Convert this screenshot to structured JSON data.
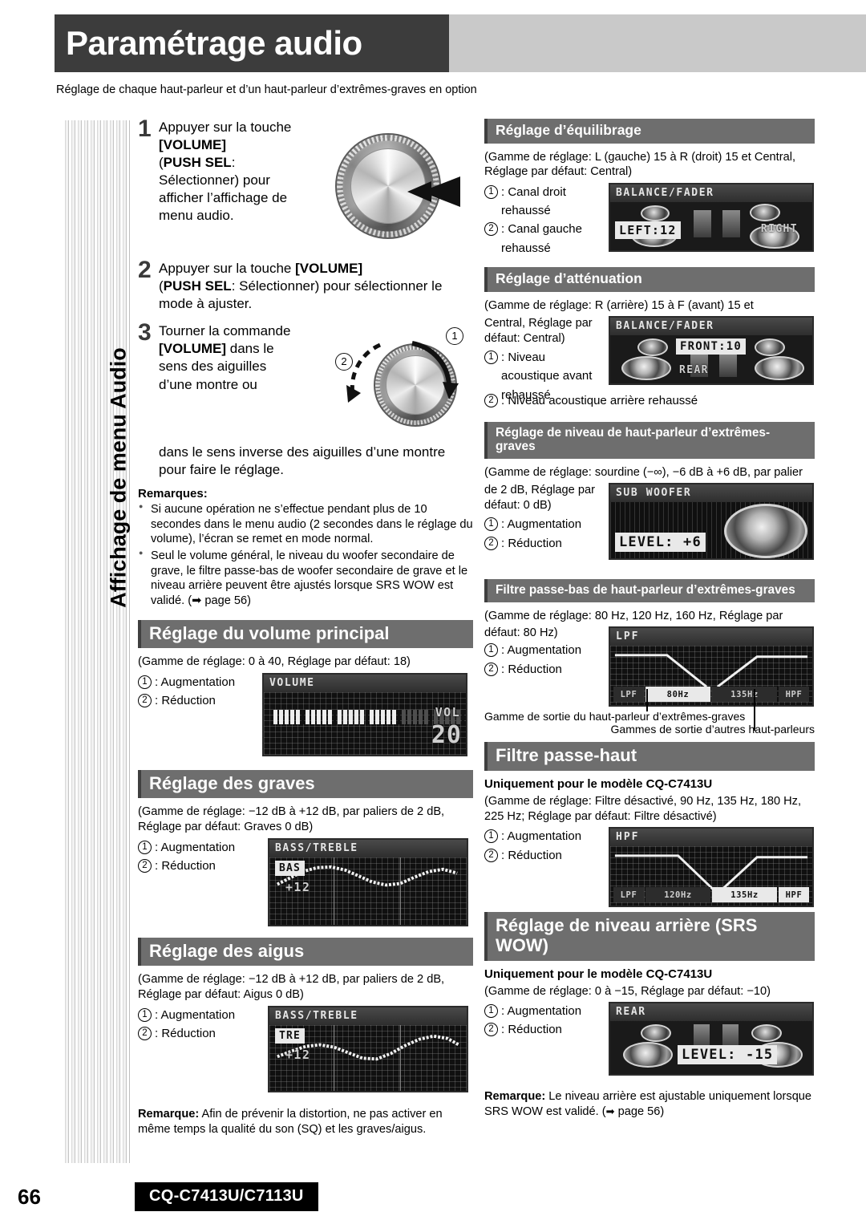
{
  "header": {
    "title": "Paramétrage audio",
    "subtitle": "Réglage de chaque haut-parleur et d’un haut-parleur d’extrêmes-graves en option"
  },
  "side_tab": {
    "label": "Affichage de menu Audio"
  },
  "steps": [
    {
      "num": "1",
      "html": "Appuyer sur la touche [VOLUME] (PUSH SEL: Sélectionner) pour afficher l’affichage de menu audio."
    },
    {
      "num": "2",
      "html": "Appuyer sur la touche [VOLUME] (PUSH SEL: Sélectionner) pour sélectionner le mode à ajuster."
    },
    {
      "num": "3",
      "html": "Tourner la commande [VOLUME] dans le sens des aiguilles d’une montre ou dans le sens inverse des aiguilles d’une montre pour faire le réglage."
    }
  ],
  "knob_marks": {
    "one": "1",
    "two": "2"
  },
  "remarques": {
    "title": "Remarques:",
    "items": [
      "Si aucune opération ne s’effectue pendant plus de 10 secondes dans le menu audio (2 secondes dans le réglage du volume), l’écran se remet en mode normal.",
      "Seul le volume général, le niveau du woofer secondaire de grave, le filtre passe-bas de woofer secondaire de grave et le niveau arrière peuvent être ajustés lorsque SRS WOW est validé. (➡ page 56)"
    ]
  },
  "sections": {
    "volume": {
      "heading": "Réglage du volume principal",
      "range": "(Gamme de réglage: 0 à 40, Réglage par défaut: 18)",
      "opt1": ": Augmentation",
      "opt2": ": Réduction",
      "lcd": {
        "title": "VOLUME",
        "label": "VOL",
        "value": "20",
        "bars_on": 20,
        "bars_total": 40
      }
    },
    "bass": {
      "heading": "Réglage des graves",
      "range": "(Gamme de réglage: −12 dB à +12 dB, par paliers de 2 dB, Réglage par défaut: Graves 0 dB)",
      "opt1": ": Augmentation",
      "opt2": ": Réduction",
      "lcd": {
        "title": "BASS/TREBLE",
        "tag": "BAS",
        "value": "+12"
      }
    },
    "treble": {
      "heading": "Réglage des aigus",
      "range": "(Gamme de réglage: −12 dB à +12 dB, par paliers de 2 dB, Réglage par défaut: Aigus 0 dB)",
      "opt1": ": Augmentation",
      "opt2": ": Réduction",
      "lcd": {
        "title": "BASS/TREBLE",
        "tag": "TRE",
        "value": "+12"
      }
    },
    "bass_treble_note": "Remarque: Afin de prévenir la distortion, ne pas activer en même temps la qualité du son (SQ) et les graves/aigus.",
    "balance": {
      "heading": "Réglage d’équilibrage",
      "range": "(Gamme de réglage: L (gauche) 15 à R (droit) 15 et Central, Réglage par défaut: Central)",
      "opt1": ": Canal droit rehaussé",
      "opt2": ": Canal gauche rehaussé",
      "lcd": {
        "title": "BALANCE/FADER",
        "value": "LEFT:12",
        "right_label": "RIGHT"
      }
    },
    "fader": {
      "heading": "Réglage d’atténuation",
      "range": "(Gamme de réglage: R (arrière) 15 à F (avant) 15 et Central, Réglage par défaut: Central)",
      "opt1": ": Niveau acoustique avant rehaussé",
      "opt2": ": Niveau acoustique arrière rehaussé",
      "lcd": {
        "title": "BALANCE/FADER",
        "value": "FRONT:10",
        "bottom_label": "REAR"
      }
    },
    "subwoofer": {
      "heading": "Réglage de niveau de haut-parleur d’extrêmes-graves",
      "range": "(Gamme de réglage: sourdine (−∞), −6 dB à +6 dB, par palier de 2 dB, Réglage par défaut: 0 dB)",
      "opt1": ": Augmentation",
      "opt2": ": Réduction",
      "lcd": {
        "title": "SUB WOOFER",
        "value": "LEVEL: +6"
      }
    },
    "lpf": {
      "heading": "Filtre passe-bas de haut-parleur d’extrêmes-graves",
      "range": "(Gamme de réglage: 80 Hz, 120 Hz, 160 Hz, Réglage par défaut: 80 Hz)",
      "opt1": ": Augmentation",
      "opt2": ": Réduction",
      "lcd": {
        "title": "LPF",
        "chips": [
          "LPF",
          "80Hz",
          "135Hz",
          "HPF"
        ],
        "active_index": 1
      },
      "caption1": "Gamme de sortie du haut-parleur d’extrêmes-graves",
      "caption2": "Gammes de sortie d’autres haut-parleurs"
    },
    "hpf": {
      "heading": "Filtre passe-haut",
      "model_note": "Uniquement pour le modèle CQ-C7413U",
      "range": "(Gamme de réglage: Filtre désactivé, 90 Hz, 135 Hz, 180 Hz, 225 Hz; Réglage par défaut: Filtre désactivé)",
      "opt1": ": Augmentation",
      "opt2": ": Réduction",
      "lcd": {
        "title": "HPF",
        "chips": [
          "LPF",
          "120Hz",
          "135Hz",
          "HPF"
        ],
        "active_index": 2
      }
    },
    "rear": {
      "heading": "Réglage de niveau arrière (SRS WOW)",
      "model_note": "Uniquement pour le modèle CQ-C7413U",
      "range": "(Gamme de réglage: 0 à −15, Réglage par défaut: −10)",
      "opt1": ": Augmentation",
      "opt2": ": Réduction",
      "lcd": {
        "title": "REAR",
        "value": "LEVEL: -15"
      }
    },
    "rear_note": "Remarque: Le niveau arrière est ajustable uniquement lorsque SRS WOW est validé. (➡ page 56)"
  },
  "footer": {
    "page": "66",
    "model": "CQ-C7413U/C7113U"
  }
}
